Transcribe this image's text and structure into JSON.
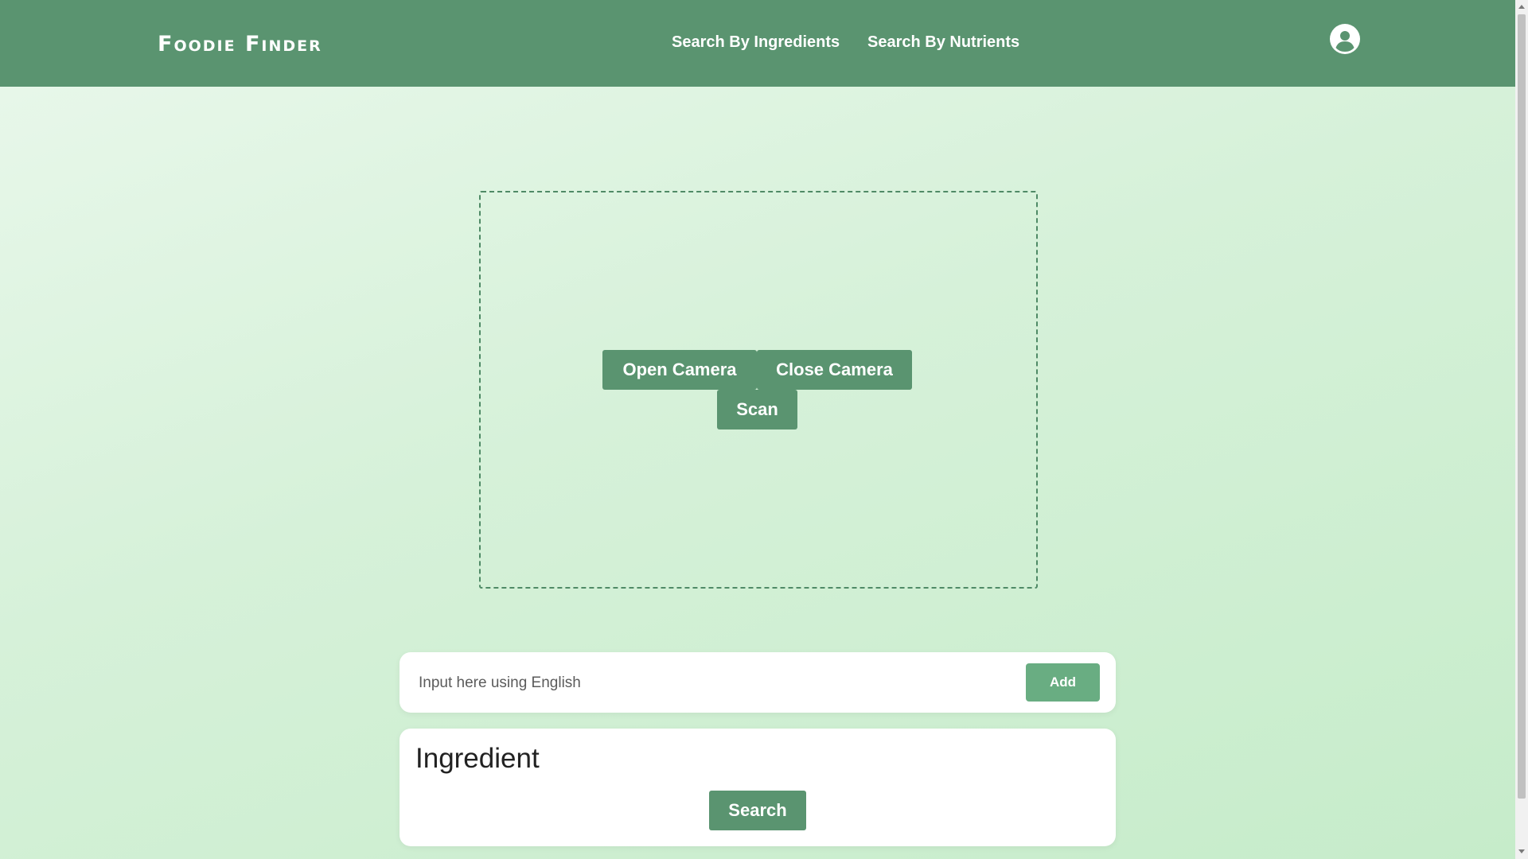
{
  "header": {
    "logo": "Foodie Finder",
    "nav": {
      "ingredients": "Search By Ingredients",
      "nutrients": "Search By Nutrients"
    },
    "avatar_icon": "user-circle-icon"
  },
  "camera": {
    "open_label": "Open Camera",
    "close_label": "Close Camera",
    "scan_label": "Scan"
  },
  "ingredient_input": {
    "placeholder": "Input here using English",
    "value": "",
    "add_label": "Add"
  },
  "ingredient_panel": {
    "title": "Ingredient",
    "search_label": "Search"
  },
  "colors": {
    "header": "#5a9470",
    "button": "#5a9470",
    "add_button": "#69ad82",
    "background_start": "#eaf8ec",
    "background_end": "#c6ecca"
  }
}
